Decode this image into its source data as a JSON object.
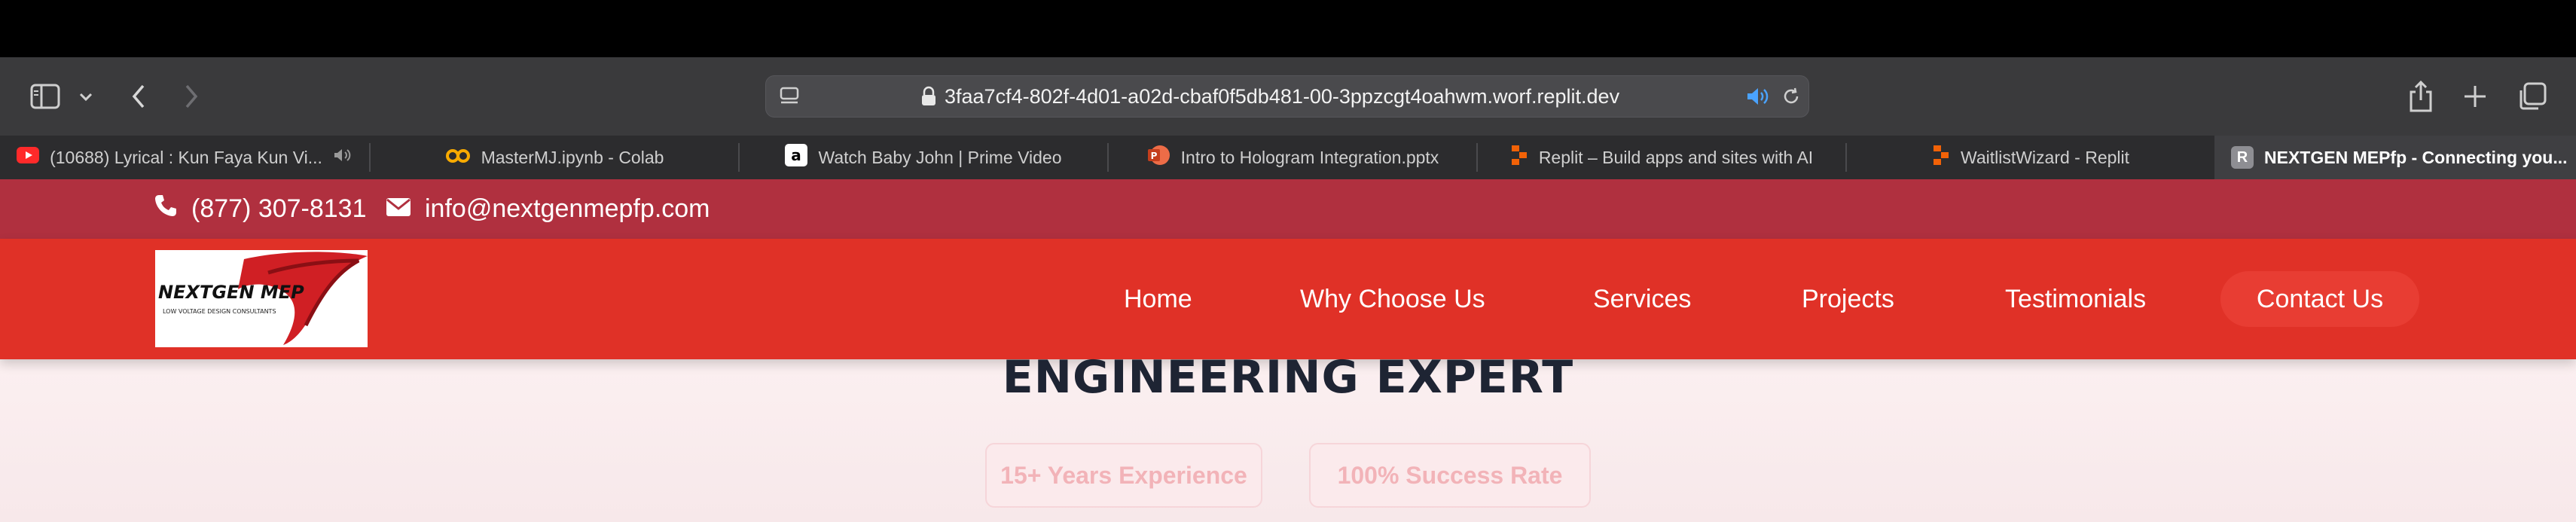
{
  "browser": {
    "url": "3faa7cf4-802f-4d01-a02d-cbaf0f5db481-00-3ppzcgt4oahwm.worf.replit.dev",
    "tabs": [
      {
        "title": "(10688) Lyrical : Kun Faya Kun Vi...",
        "icon": "youtube-icon",
        "audio": true
      },
      {
        "title": "MasterMJ.ipynb - Colab",
        "icon": "colab-icon"
      },
      {
        "title": "Watch Baby John | Prime Video",
        "icon": "amazon-icon"
      },
      {
        "title": "Intro to Hologram Integration.pptx",
        "icon": "powerpoint-icon"
      },
      {
        "title": "Replit – Build apps and sites with AI",
        "icon": "replit-icon"
      },
      {
        "title": "WaitlistWizard - Replit",
        "icon": "replit-icon"
      },
      {
        "title": "NEXTGEN MEPfp - Connecting you...",
        "icon": "r-letter-icon",
        "icon_letter": "R",
        "active": true
      }
    ]
  },
  "site": {
    "topbar": {
      "phone": "(877) 307-8131",
      "email": "info@nextgenmepfp.com"
    },
    "logo": {
      "name": "NEXTGEN MEP",
      "tagline": "LOW VOLTAGE DESIGN CONSULTANTS"
    },
    "nav": {
      "items": [
        "Home",
        "Why Choose Us",
        "Services",
        "Projects",
        "Testimonials"
      ],
      "cta": "Contact Us"
    },
    "hero": {
      "title": "ENGINEERING EXPERT",
      "stats": [
        "15+ Years Experience",
        "100% Success Rate"
      ]
    }
  },
  "colors": {
    "topbar": "#b0303f",
    "navbar": "#e03127",
    "accent": "#e83d33"
  }
}
